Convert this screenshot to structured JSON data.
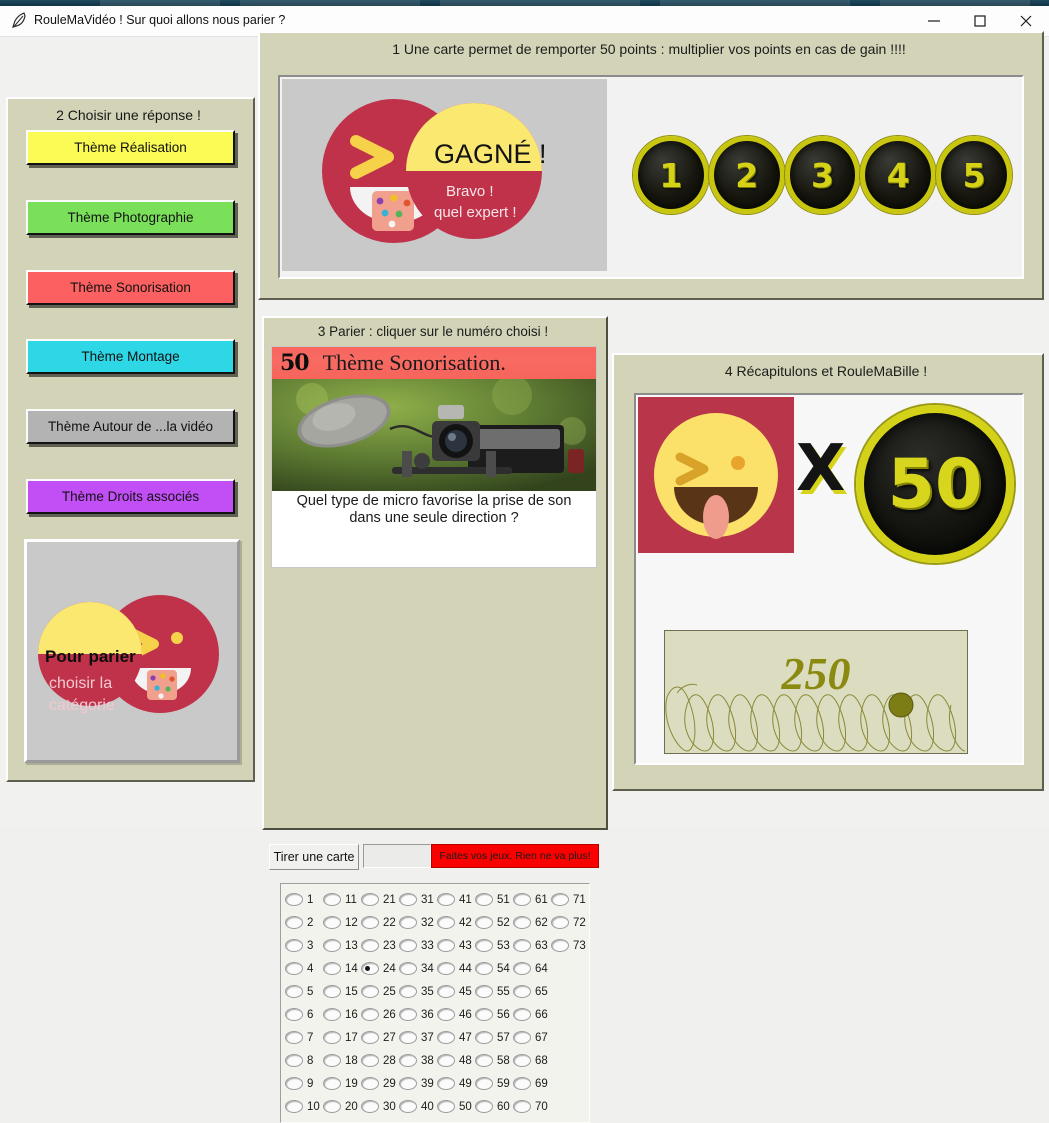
{
  "window": {
    "title": "RouleMaVidéo ! Sur quoi allons nous parier ?",
    "icon": "feather-icon",
    "minimize_label": "—",
    "maximize_label": "□",
    "close_label": "✕"
  },
  "sidebar": {
    "title": "2 Choisir une réponse !",
    "buttons": [
      {
        "label": "Thème Réalisation",
        "color": "#fbfb55"
      },
      {
        "label": "Thème Photographie",
        "color": "#7ae05a"
      },
      {
        "label": "Thème Sonorisation",
        "color": "#fc6060"
      },
      {
        "label": "Thème Montage",
        "color": "#2ed7e6"
      },
      {
        "label": "Thème Autour de ...la vidéo",
        "color": "#b3b3b3"
      },
      {
        "label": "Thème Droits associés",
        "color": "#c24ef5"
      }
    ],
    "logo": {
      "line1": "Pour parier",
      "line2": "choisir la",
      "line3": "catégorie"
    }
  },
  "top_panel": {
    "title": "1 Une carte permet de remporter 50 points : multiplier vos points en cas de gain !!!!",
    "win_banner": {
      "headline": "GAGNÉ !",
      "sub1": "Bravo !",
      "sub2": "quel expert !"
    },
    "tokens": [
      "1",
      "2",
      "3",
      "4",
      "5"
    ]
  },
  "mid_panel": {
    "title": "3 Parier : cliquer sur le numéro choisi !",
    "card": {
      "badge": "50",
      "theme": "Thème Sonorisation.",
      "question_line1": "Quel type de micro favorise la prise de son",
      "question_line2": "dans une seule direction ?"
    },
    "draw_button": "Tirer une carte",
    "marquee": "Faites vos jeux. Rien ne va plus!",
    "grid": {
      "selected": "24",
      "rows": [
        [
          "1",
          "11",
          "21",
          "31",
          "41",
          "51",
          "61",
          "71"
        ],
        [
          "2",
          "12",
          "22",
          "32",
          "42",
          "52",
          "62",
          "72"
        ],
        [
          "3",
          "13",
          "23",
          "33",
          "43",
          "53",
          "63",
          "73"
        ],
        [
          "4",
          "14",
          "24",
          "34",
          "44",
          "54",
          "64"
        ],
        [
          "5",
          "15",
          "25",
          "35",
          "45",
          "55",
          "65"
        ],
        [
          "6",
          "16",
          "26",
          "36",
          "46",
          "56",
          "66"
        ],
        [
          "7",
          "17",
          "27",
          "37",
          "47",
          "57",
          "67"
        ],
        [
          "8",
          "18",
          "28",
          "38",
          "48",
          "58",
          "68"
        ],
        [
          "9",
          "19",
          "29",
          "39",
          "49",
          "59",
          "69"
        ],
        [
          "10",
          "20",
          "30",
          "40",
          "50",
          "60",
          "70"
        ]
      ]
    }
  },
  "right_panel": {
    "title": "4 Récapitulons et RouleMaBille !",
    "multiplier_symbol": "X",
    "coin_value": "50",
    "score": "250"
  },
  "colors": {
    "panel_khaki": "#d3d3b7",
    "accent_red": "#f7645b",
    "token_gold": "#d4d218",
    "score_olive": "#8a8a10",
    "marquee_red": "#fb0000"
  }
}
